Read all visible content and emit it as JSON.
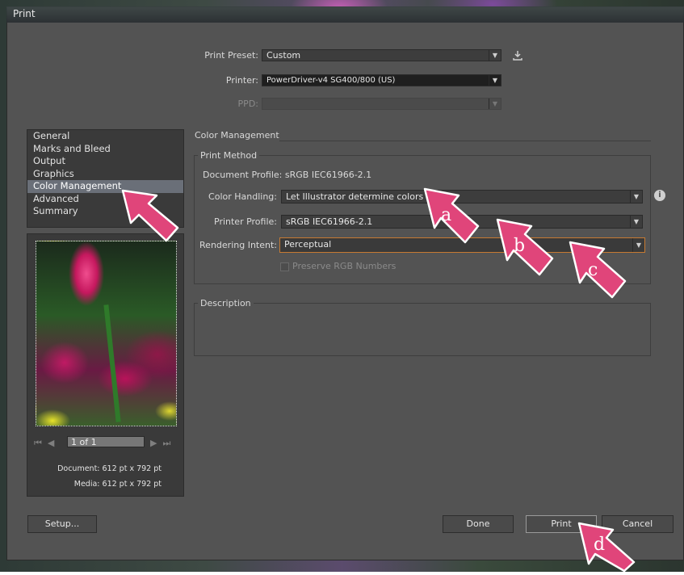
{
  "window": {
    "title": "Print"
  },
  "top_fields": {
    "print_preset": {
      "label": "Print Preset:",
      "value": "Custom"
    },
    "printer": {
      "label": "Printer:",
      "value": "PowerDriver-v4 SG400/800 (US)"
    },
    "ppd": {
      "label": "PPD:",
      "value": ""
    }
  },
  "sidebar": {
    "items": [
      {
        "label": "General"
      },
      {
        "label": "Marks and Bleed"
      },
      {
        "label": "Output"
      },
      {
        "label": "Graphics"
      },
      {
        "label": "Color Management"
      },
      {
        "label": "Advanced"
      },
      {
        "label": "Summary"
      }
    ],
    "active_index": 4
  },
  "preview": {
    "page_field": "1 of 1",
    "document_label": "Document: 612 pt x 792 pt",
    "media_label": "Media: 612 pt x 792 pt"
  },
  "color_management": {
    "section_title": "Color Management",
    "print_method_title": "Print Method",
    "document_profile": "Document Profile: sRGB IEC61966-2.1",
    "color_handling": {
      "label": "Color Handling:",
      "value": "Let Illustrator determine colors"
    },
    "printer_profile": {
      "label": "Printer Profile:",
      "value": "sRGB IEC61966-2.1"
    },
    "rendering_intent": {
      "label": "Rendering Intent:",
      "value": "Perceptual"
    },
    "preserve_rgb": {
      "label": "Preserve RGB Numbers",
      "checked": false
    }
  },
  "description": {
    "title": "Description"
  },
  "buttons": {
    "setup": "Setup...",
    "done": "Done",
    "print": "Print",
    "cancel": "Cancel"
  },
  "annotations": {
    "a": "a",
    "b": "b",
    "c": "c",
    "d": "d"
  },
  "colors": {
    "marker": "#e0457a",
    "focus": "#c67a32",
    "dialog": "#535353"
  }
}
